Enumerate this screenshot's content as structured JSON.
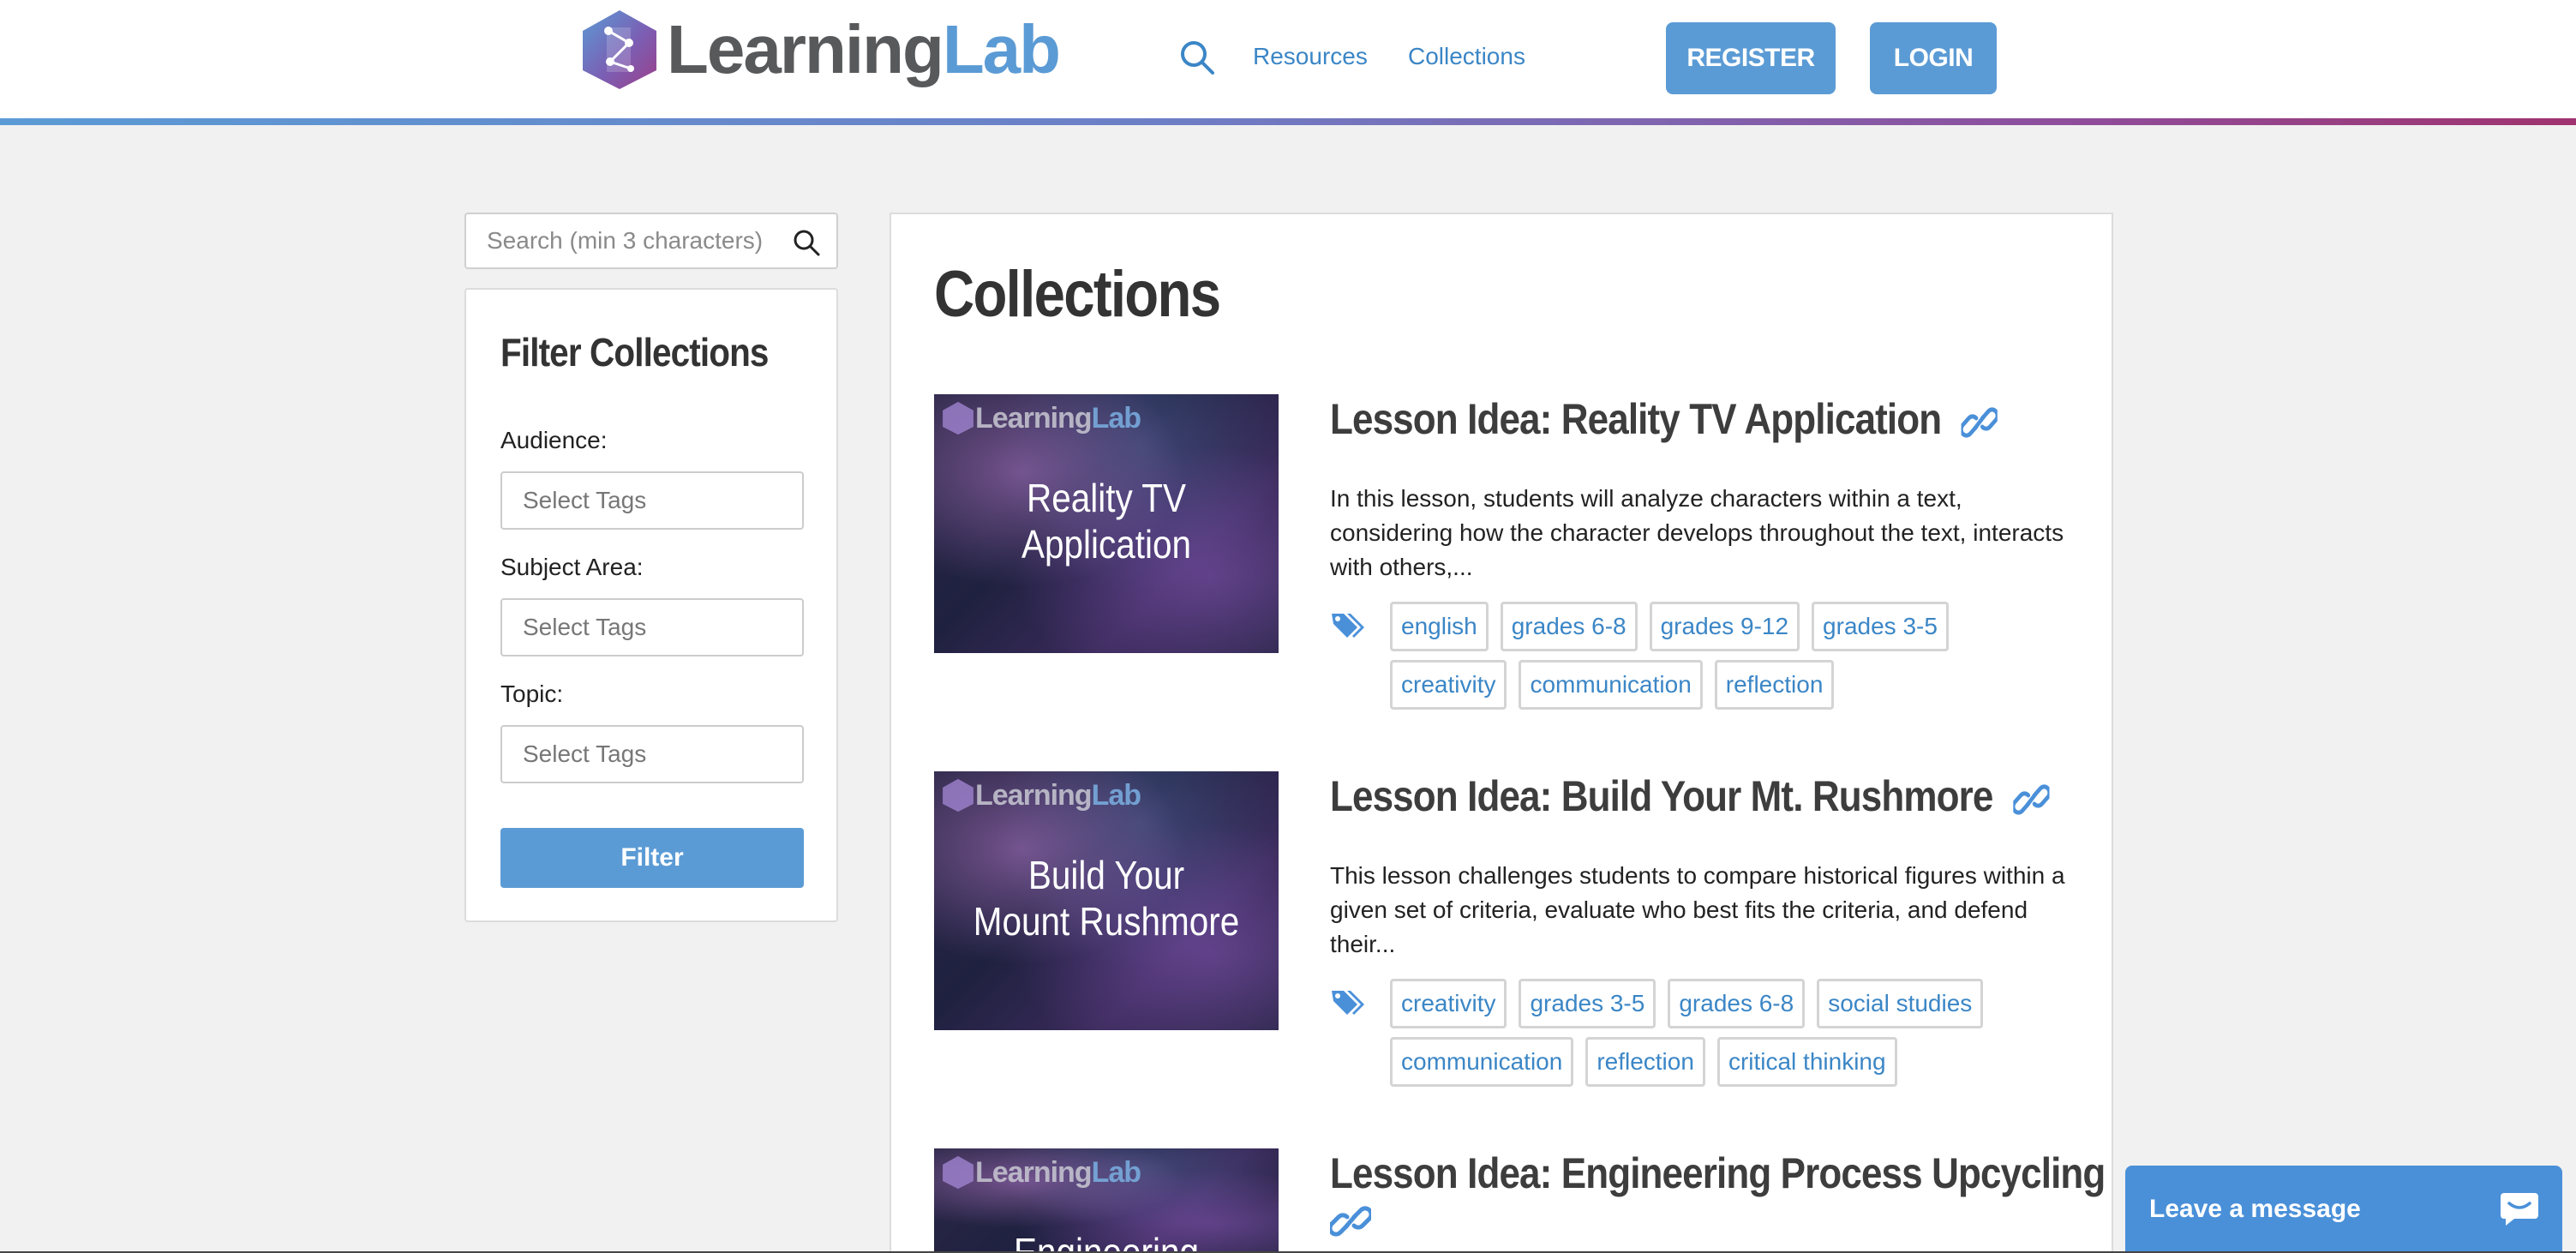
{
  "header": {
    "logo_part1": "Learning",
    "logo_part2": "Lab",
    "nav": [
      "Resources",
      "Collections"
    ],
    "register_label": "REGISTER",
    "login_label": "LOGIN",
    "search_icon": "search-icon",
    "brand_colors": {
      "blue": "#5b9bd5",
      "gray": "#58595b",
      "purple": "#8e4e9c"
    }
  },
  "sidebar": {
    "search_placeholder": "Search (min 3 characters)",
    "filter_title": "Filter Collections",
    "audience_label": "Audience:",
    "subject_label": "Subject Area:",
    "topic_label": "Topic:",
    "select_placeholder": "Select Tags",
    "filter_button": "Filter"
  },
  "main": {
    "title": "Collections",
    "items": [
      {
        "title": "Lesson Idea: Reality TV Application",
        "thumb_line1": "Reality TV",
        "thumb_line2": "Application",
        "description": "In this lesson, students will analyze characters within a text, considering how the character develops throughout the text, interacts with others,...",
        "tags": [
          "english",
          "grades 6-8",
          "grades 9-12",
          "grades 3-5",
          "creativity",
          "communication",
          "reflection"
        ]
      },
      {
        "title": "Lesson Idea: Build Your Mt. Rushmore",
        "thumb_line1": "Build Your",
        "thumb_line2": "Mount Rushmore",
        "description": "This lesson challenges students to compare historical figures within a given set of criteria, evaluate who best fits the criteria, and defend their...",
        "tags": [
          "creativity",
          "grades 3-5",
          "grades 6-8",
          "social studies",
          "communication",
          "reflection",
          "critical thinking"
        ]
      },
      {
        "title": "Lesson Idea: Engineering Process Upcycling",
        "thumb_line1": "Engineering"
      }
    ]
  },
  "chat": {
    "label": "Leave a message",
    "icon": "chat-bubble-icon"
  }
}
